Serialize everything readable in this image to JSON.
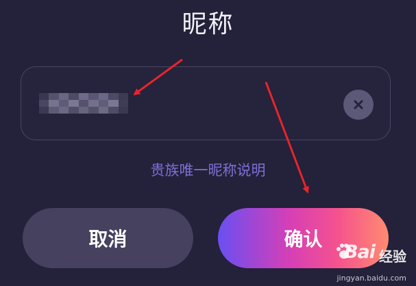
{
  "title": "昵称",
  "nickname_field": {
    "value": "▇▇▇▇",
    "clear_icon": "close-icon"
  },
  "explain_link": "贵族唯一昵称说明",
  "buttons": {
    "cancel_label": "取消",
    "confirm_label": "确认"
  },
  "watermark": {
    "brand": "Bai",
    "brand_cn": "经验",
    "url": "jingyan.baidu.com"
  },
  "colors": {
    "background": "#24213a",
    "link": "#7f6fd6",
    "annotation_arrow": "#e8252a"
  }
}
